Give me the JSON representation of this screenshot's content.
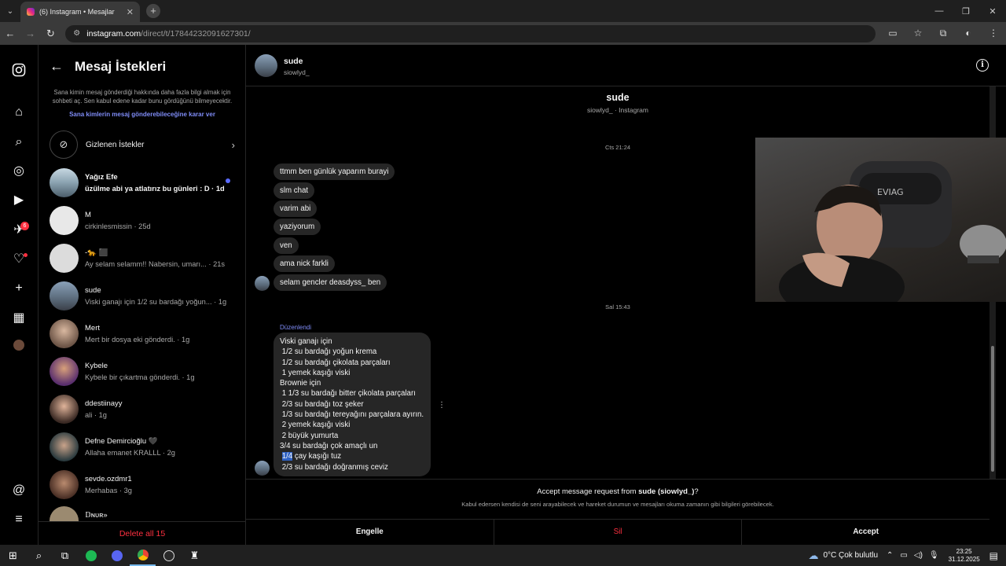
{
  "browser": {
    "tab_title": "(6) Instagram • Mesajlar",
    "url_host": "instagram.com",
    "url_path": "/direct/t/17844232091627301/"
  },
  "rail": {
    "icons": [
      "instagram-icon",
      "home-icon",
      "search-icon",
      "explore-icon",
      "reels-icon",
      "messages-icon",
      "notifications-icon",
      "create-icon",
      "dashboard-icon",
      "profile-avatar",
      "threads-icon",
      "menu-icon"
    ],
    "messages_badge": "6"
  },
  "requests": {
    "title": "Mesaj İstekleri",
    "info": "Sana kimin mesaj gönderdiği hakkında daha fazla bilgi almak için sohbeti aç. Sen kabul edene kadar bunu gördüğünü bilmeyecektir.",
    "settings_link": "Sana kimlerin mesaj gönderebileceğine karar ver",
    "hidden_label": "Gizlenen İstekler",
    "items": [
      {
        "name": "Yağız Efe",
        "preview": "üzülme abi ya atlatırız bu günleri : D · 1d",
        "unread": true
      },
      {
        "name": "M",
        "preview": "cirkinlesmissin · 25d",
        "unread": false
      },
      {
        "name": "-🐆 ⬛",
        "preview": "Ay selam selamm!! Nabersin, umarı...  · 21s",
        "unread": false
      },
      {
        "name": "sude",
        "preview": "Viski ganajı için 1/2 su bardağı yoğun... · 1g",
        "unread": false
      },
      {
        "name": "Mert",
        "preview": "Mert bir dosya eki gönderdi. · 1g",
        "unread": false
      },
      {
        "name": "Kybele",
        "preview": "Kybele bir çıkartma gönderdi. · 1g",
        "unread": false
      },
      {
        "name": "ddestiinayy",
        "preview": "ali · 1g",
        "unread": false
      },
      {
        "name": "Defne Demircioğlu 🖤",
        "preview": "Allaha emanet KRALLL · 2g",
        "unread": false
      },
      {
        "name": "sevde.ozdmr1",
        "preview": "Merhabas · 3g",
        "unread": false
      },
      {
        "name": "𝔻ɴᴜʀ»",
        "preview": "",
        "unread": false
      }
    ],
    "delete_all": "Delete all 15"
  },
  "chat": {
    "name": "sude",
    "username": "siowlyd_",
    "profile_sub": "siowlyd_ · Instagram",
    "ts1": "Cts 21:24",
    "messages1": [
      "ttmm ben günlük yaparım burayi",
      "slm chat",
      "varim abi",
      "yaziyorum",
      "ven",
      "ama nick farkli",
      "selam gencler deasdyss_ ben"
    ],
    "ts2": "Sal 15:43",
    "edited_label": "Düzenlendi",
    "recipe_lines": [
      "Viski ganajı için",
      " 1/2 su bardağı yoğun krema",
      " 1/2 su bardağı çikolata parçaları",
      " 1 yemek kaşığı viski",
      "Brownie için",
      " 1 1/3 su bardağı bitter çikolata parçaları",
      " 2/3 su bardağı toz şeker",
      " 1/3 su bardağı tereyağını parçalara ayırın.",
      " 2 yemek kaşığı viski",
      " 2 büyük yumurta",
      " 3/4 su bardağı çok amaçlı un"
    ],
    "recipe_sel": "1/4",
    "recipe_sel_rest": " çay kaşığı tuz",
    "recipe_last": " 2/3 su bardağı doğranmış ceviz",
    "accept_q_pre": "Accept message request from ",
    "accept_q_name": "sude (siowlyd_)",
    "accept_q_post": "?",
    "accept_desc": "Kabul edersen kendisi de seni arayabilecek ve hareket durumun ve mesajları okuma zamanın gibi bilgileri görebilecek.",
    "btn_block": "Engelle",
    "btn_delete": "Sil",
    "btn_accept": "Accept"
  },
  "taskbar": {
    "weather": "0°C  Çok bulutlu",
    "time": "23:25",
    "date": "31.12.2025"
  }
}
